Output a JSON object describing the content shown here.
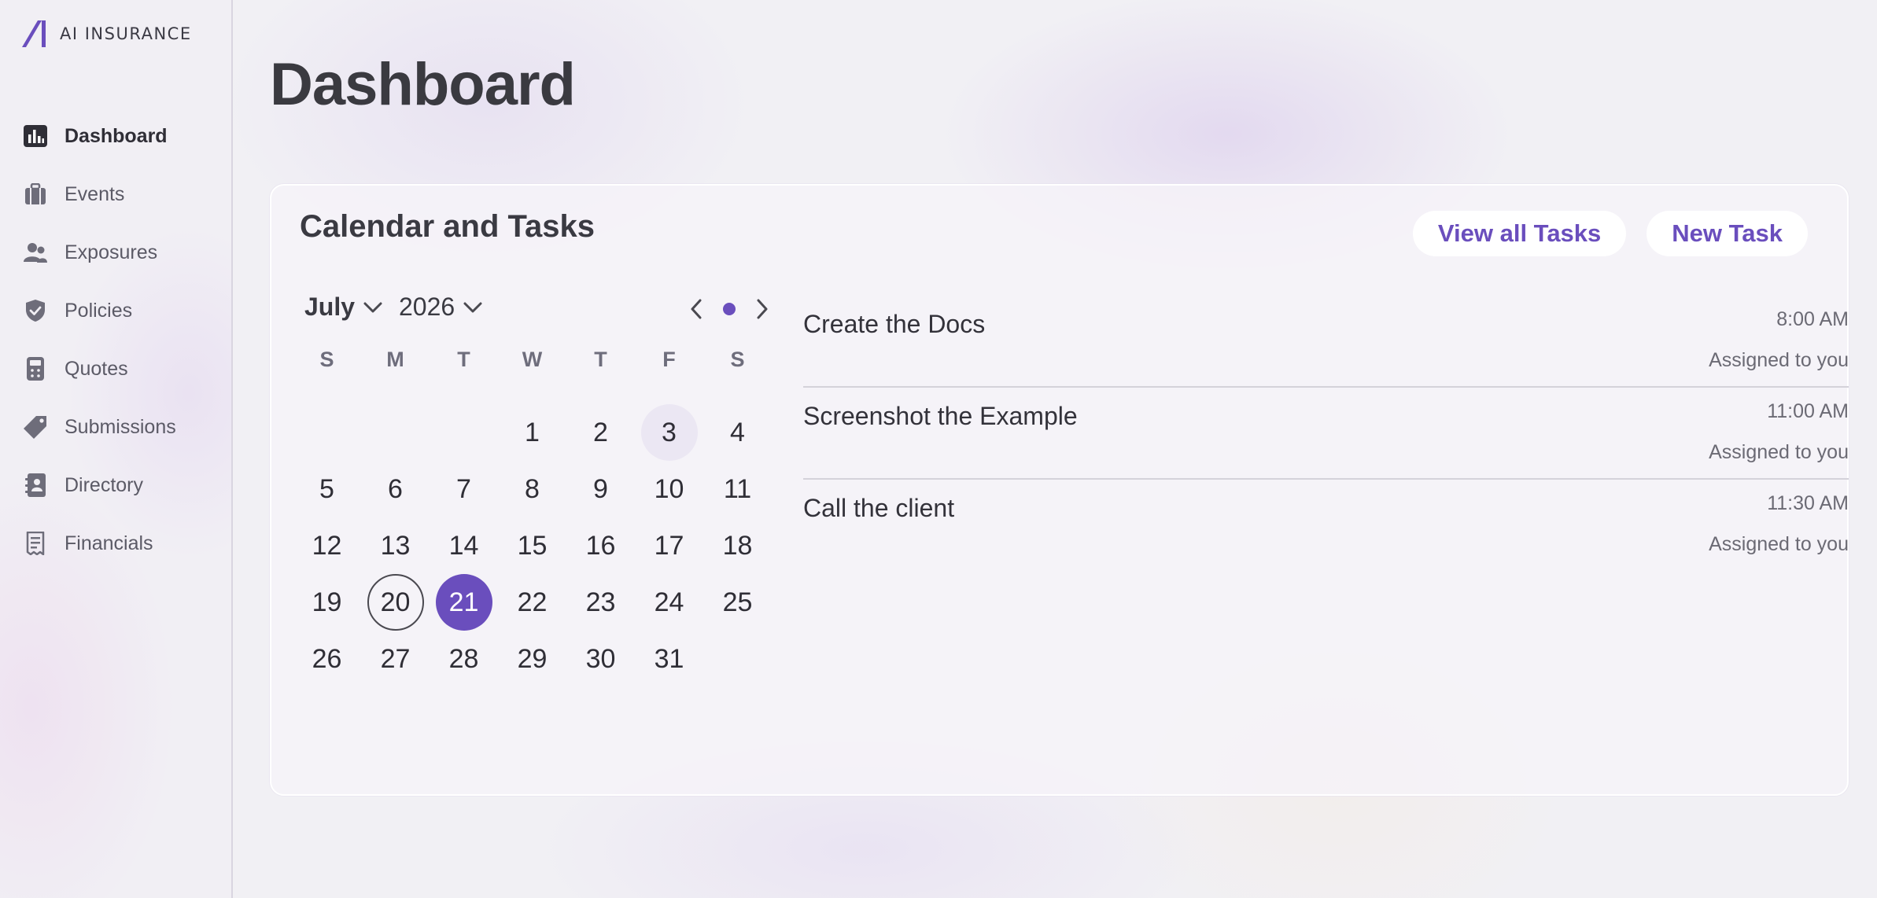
{
  "brand": {
    "name": "AI INSURANCE",
    "accent": "#6a4ebd"
  },
  "sidebar": {
    "items": [
      {
        "label": "Dashboard",
        "icon": "chart-bar-icon",
        "active": true
      },
      {
        "label": "Events",
        "icon": "briefcase-icon",
        "active": false
      },
      {
        "label": "Exposures",
        "icon": "users-icon",
        "active": false
      },
      {
        "label": "Policies",
        "icon": "shield-icon",
        "active": false
      },
      {
        "label": "Quotes",
        "icon": "calculator-icon",
        "active": false
      },
      {
        "label": "Submissions",
        "icon": "tag-icon",
        "active": false
      },
      {
        "label": "Directory",
        "icon": "contact-book-icon",
        "active": false
      },
      {
        "label": "Financials",
        "icon": "receipt-icon",
        "active": false
      }
    ]
  },
  "header": {
    "title": "Dashboard"
  },
  "card": {
    "title": "Calendar and Tasks",
    "view_all_label": "View all Tasks",
    "new_task_label": "New Task"
  },
  "calendar": {
    "month": "July",
    "year": "2026",
    "weekdays": [
      "S",
      "M",
      "T",
      "W",
      "T",
      "F",
      "S"
    ],
    "first_weekday_index": 3,
    "days_in_month": 31,
    "highlighted_day": 3,
    "today": 20,
    "selected_day": 21
  },
  "tasks": [
    {
      "title": "Create the Docs",
      "time": "8:00 AM",
      "assignee": "Assigned to you"
    },
    {
      "title": "Screenshot the Example",
      "time": "11:00 AM",
      "assignee": "Assigned to you"
    },
    {
      "title": "Call the client",
      "time": "11:30 AM",
      "assignee": "Assigned to you"
    }
  ]
}
